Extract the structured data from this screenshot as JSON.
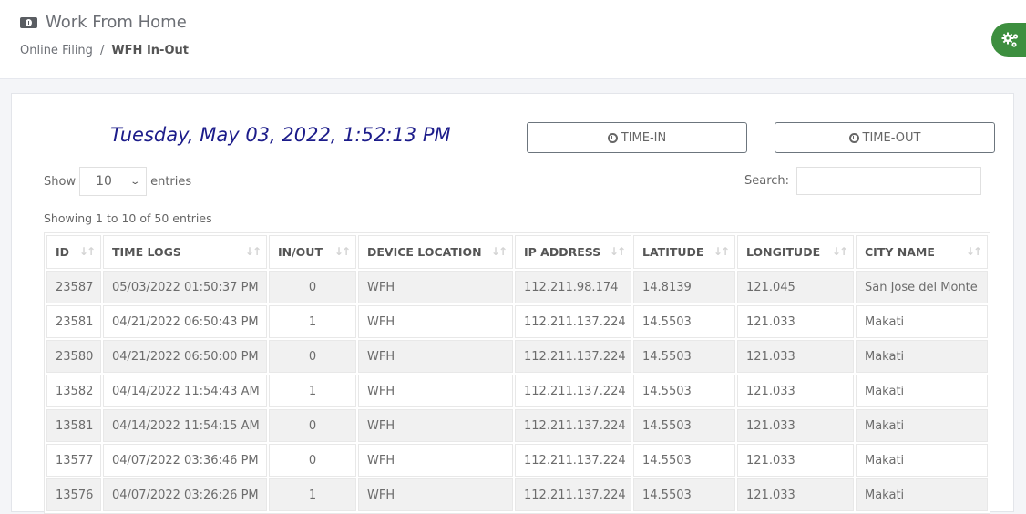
{
  "header": {
    "title": "Work From Home",
    "title_icon": "money-bill-icon",
    "breadcrumb": {
      "parent": "Online Filing",
      "separator": "/",
      "current": "WFH In-Out"
    },
    "settings_icon": "cogs-icon"
  },
  "clock": {
    "datetime": "Tuesday, May 03, 2022, 1:52:13 PM"
  },
  "actions": {
    "time_in_label": "TIME-IN",
    "time_out_label": "TIME-OUT",
    "icon": "clock-icon"
  },
  "controls": {
    "show_label": "Show",
    "entries_label": "entries",
    "page_length": "10",
    "search_label": "Search:",
    "search_value": "",
    "info": "Showing 1 to 10 of 50 entries"
  },
  "colors": {
    "clock_text": "#1c1c8a",
    "fab_green": "#3d8f3f",
    "striped_row": "#f1f1f1"
  },
  "table": {
    "columns": [
      "ID",
      "TIME LOGS",
      "IN/OUT",
      "DEVICE LOCATION",
      "IP ADDRESS",
      "LATITUDE",
      "LONGITUDE",
      "CITY NAME"
    ],
    "rows": [
      [
        "23587",
        "05/03/2022 01:50:37 PM",
        "0",
        "WFH",
        "112.211.98.174",
        "14.8139",
        "121.045",
        "San Jose del Monte"
      ],
      [
        "23581",
        "04/21/2022 06:50:43 PM",
        "1",
        "WFH",
        "112.211.137.224",
        "14.5503",
        "121.033",
        "Makati"
      ],
      [
        "23580",
        "04/21/2022 06:50:00 PM",
        "0",
        "WFH",
        "112.211.137.224",
        "14.5503",
        "121.033",
        "Makati"
      ],
      [
        "13582",
        "04/14/2022 11:54:43 AM",
        "1",
        "WFH",
        "112.211.137.224",
        "14.5503",
        "121.033",
        "Makati"
      ],
      [
        "13581",
        "04/14/2022 11:54:15 AM",
        "0",
        "WFH",
        "112.211.137.224",
        "14.5503",
        "121.033",
        "Makati"
      ],
      [
        "13577",
        "04/07/2022 03:36:46 PM",
        "0",
        "WFH",
        "112.211.137.224",
        "14.5503",
        "121.033",
        "Makati"
      ],
      [
        "13576",
        "04/07/2022 03:26:26 PM",
        "1",
        "WFH",
        "112.211.137.224",
        "14.5503",
        "121.033",
        "Makati"
      ]
    ]
  }
}
